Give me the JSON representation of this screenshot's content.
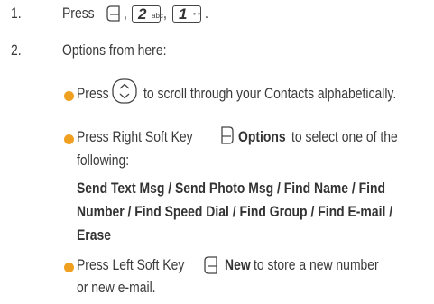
{
  "steps": [
    {
      "number": "1.",
      "parts": [
        "Press",
        ",",
        ",",
        "."
      ],
      "keys": {
        "left_soft_key_icon": "left-soft-key-icon",
        "key2": {
          "digit": "2",
          "letters": "abc"
        },
        "key1": {
          "digit": "1",
          "letters": "∘∘"
        }
      }
    },
    {
      "number": "2.",
      "intro": "Options from here:",
      "bullets": [
        {
          "pre": "Press",
          "post": "to scroll through your Contacts alphabetically."
        },
        {
          "pre": "Press Right Soft Key",
          "bold": "Options",
          "post": "to select one of the",
          "line2": "following:",
          "options_line1": "Send Text Msg / Send Photo Msg / Find Name / Find",
          "options_line2": "Number / Find Speed Dial / Find Group / Find E-mail /",
          "options_line3": "Erase"
        },
        {
          "pre": "Press Left Soft Key",
          "bold": "New",
          "post": "to store a new number",
          "line2": "or new e-mail."
        }
      ]
    }
  ],
  "colors": {
    "bullet": "#f0a020",
    "text": "#3a3a3a"
  }
}
